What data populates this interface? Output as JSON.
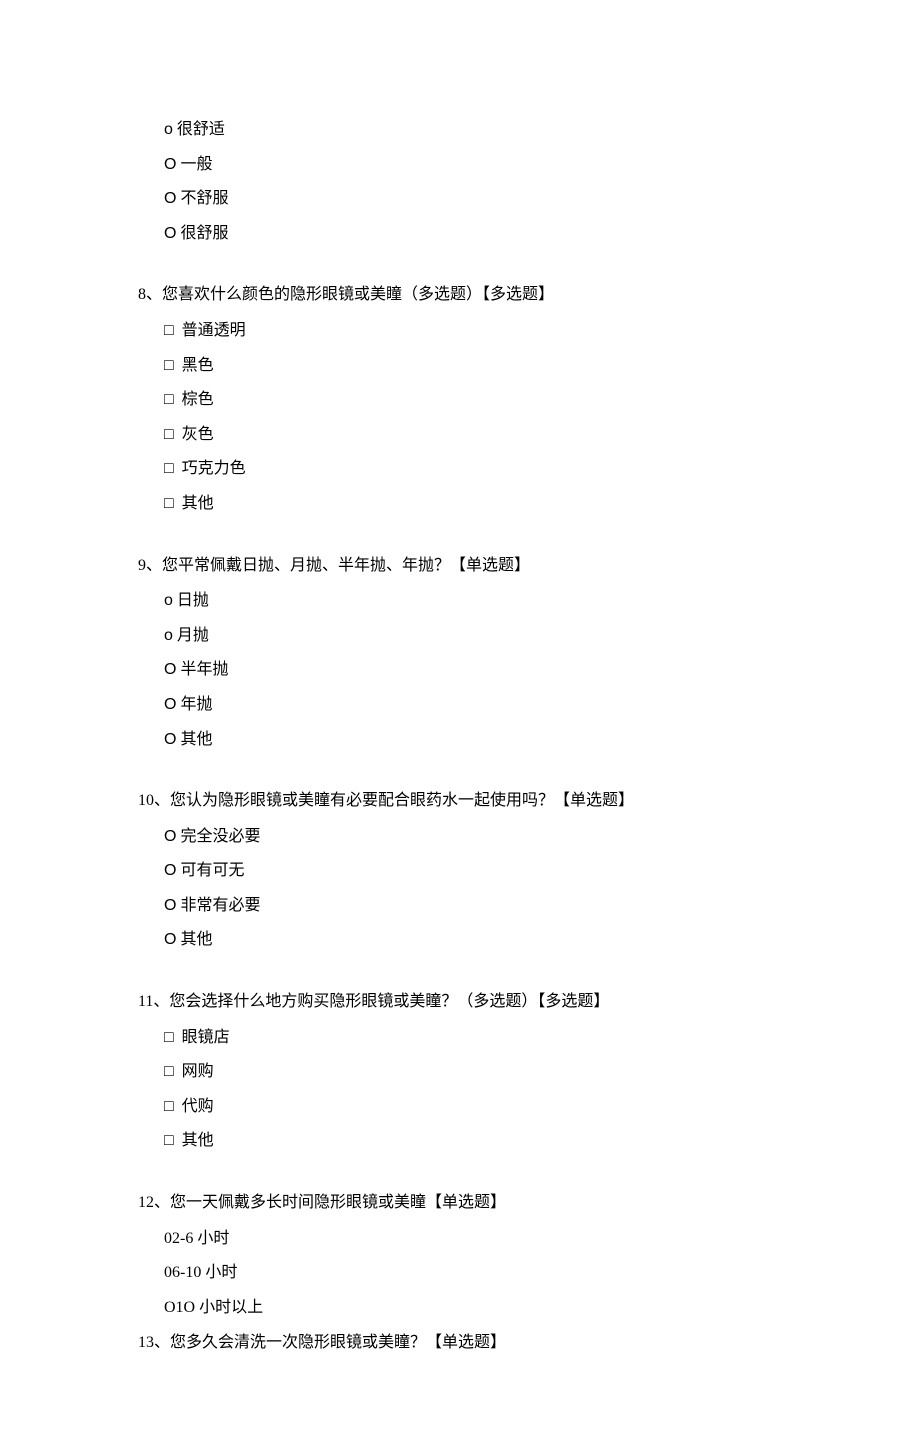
{
  "orphan": {
    "opt1_bullet": "o",
    "opt1_text": "很舒适",
    "opt2_bullet": "O",
    "opt2_text": "一般",
    "opt3_bullet": "O",
    "opt3_text": "不舒服",
    "opt4_bullet": "O",
    "opt4_text": "很舒服"
  },
  "q8": {
    "title": "8、您喜欢什么颜色的隐形眼镜或美瞳（多选题）【多选题】",
    "cb": "□",
    "opt1": "普通透明",
    "opt2": "黑色",
    "opt3": "棕色",
    "opt4": "灰色",
    "opt5": "巧克力色",
    "opt6": "其他"
  },
  "q9": {
    "title": "9、您平常佩戴日抛、月抛、半年抛、年抛？【单选题】",
    "opt1_bullet": "o",
    "opt1_text": "日抛",
    "opt2_bullet": "o",
    "opt2_text": "月抛",
    "opt3_bullet": "O",
    "opt3_text": "半年抛",
    "opt4_bullet": "O",
    "opt4_text": "年抛",
    "opt5_bullet": "O",
    "opt5_text": "其他"
  },
  "q10": {
    "title": "10、您认为隐形眼镜或美瞳有必要配合眼药水一起使用吗？【单选题】",
    "opt1_bullet": "O",
    "opt1_text": "完全没必要",
    "opt2_bullet": "O",
    "opt2_text": "可有可无",
    "opt3_bullet": "O",
    "opt3_text": "非常有必要",
    "opt4_bullet": "O",
    "opt4_text": "其他"
  },
  "q11": {
    "title": "11、您会选择什么地方购买隐形眼镜或美瞳？（多选题）【多选题】",
    "cb": "□",
    "opt1": "眼镜店",
    "opt2": "网购",
    "opt3": "代购",
    "opt4": "其他"
  },
  "q12": {
    "title": "12、您一天佩戴多长时间隐形眼镜或美瞳【单选题】",
    "opt1": "02-6 小时",
    "opt2": "06-10 小时",
    "opt3": "O1O 小时以上"
  },
  "q13": {
    "title": "13、您多久会清洗一次隐形眼镜或美瞳？【单选题】"
  }
}
